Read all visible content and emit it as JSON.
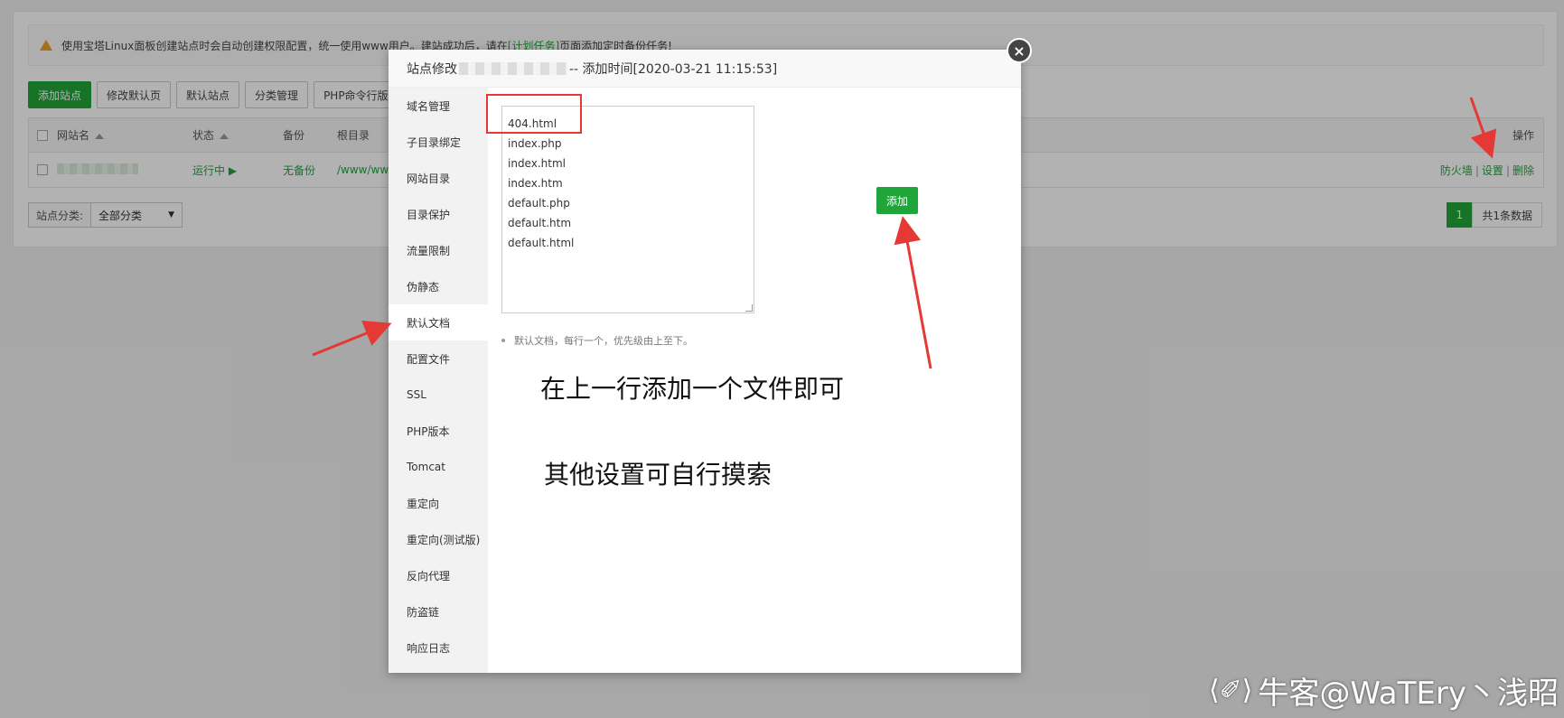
{
  "notice": {
    "text_before": "使用宝塔Linux面板创建站点时会自动创建权限配置，统一使用www用户。建站成功后，请在",
    "link": "[计划任务]",
    "text_after": "页面添加定时备份任务!"
  },
  "toolbar": {
    "add_site": "添加站点",
    "edit_default_page": "修改默认页",
    "default_site": "默认站点",
    "category_manage": "分类管理",
    "php_cli": "PHP命令行版本"
  },
  "table": {
    "headers": {
      "site_name": "网站名",
      "status": "状态",
      "backup": "备份",
      "root": "根目录",
      "ops": "操作"
    },
    "row": {
      "status": "运行中 ▶",
      "backup": "无备份",
      "root": "/www/ww",
      "op_firewall": "防火墙",
      "op_settings": "设置",
      "op_delete": "删除",
      "sep": "|"
    }
  },
  "filter": {
    "label": "站点分类:",
    "value": "全部分类",
    "caret": "▼"
  },
  "pager": {
    "page": "1",
    "total": "共1条数据"
  },
  "modal": {
    "title_prefix": "站点修改",
    "title_suffix": "-- 添加时间[2020-03-21 11:15:53]",
    "close": "×",
    "sidebar": [
      "域名管理",
      "子目录绑定",
      "网站目录",
      "目录保护",
      "流量限制",
      "伪静态",
      "默认文档",
      "配置文件",
      "SSL",
      "PHP版本",
      "Tomcat",
      "重定向",
      "重定向(测试版)",
      "反向代理",
      "防盗链",
      "响应日志"
    ],
    "active_index": 6,
    "documents": [
      "404.html",
      "index.php",
      "index.html",
      "index.htm",
      "default.php",
      "default.htm",
      "default.html"
    ],
    "add_button": "添加",
    "tip": "默认文档，每行一个，优先级由上至下。"
  },
  "annotations": {
    "line1": "在上一行添加一个文件即可",
    "line2": "其他设置可自行摸索"
  },
  "watermark": {
    "icon": "⟨✐⟩",
    "text": "牛客@WaTEry丶浅昭"
  },
  "colors": {
    "accent": "#20a53a",
    "annotation_red": "#e53935"
  }
}
